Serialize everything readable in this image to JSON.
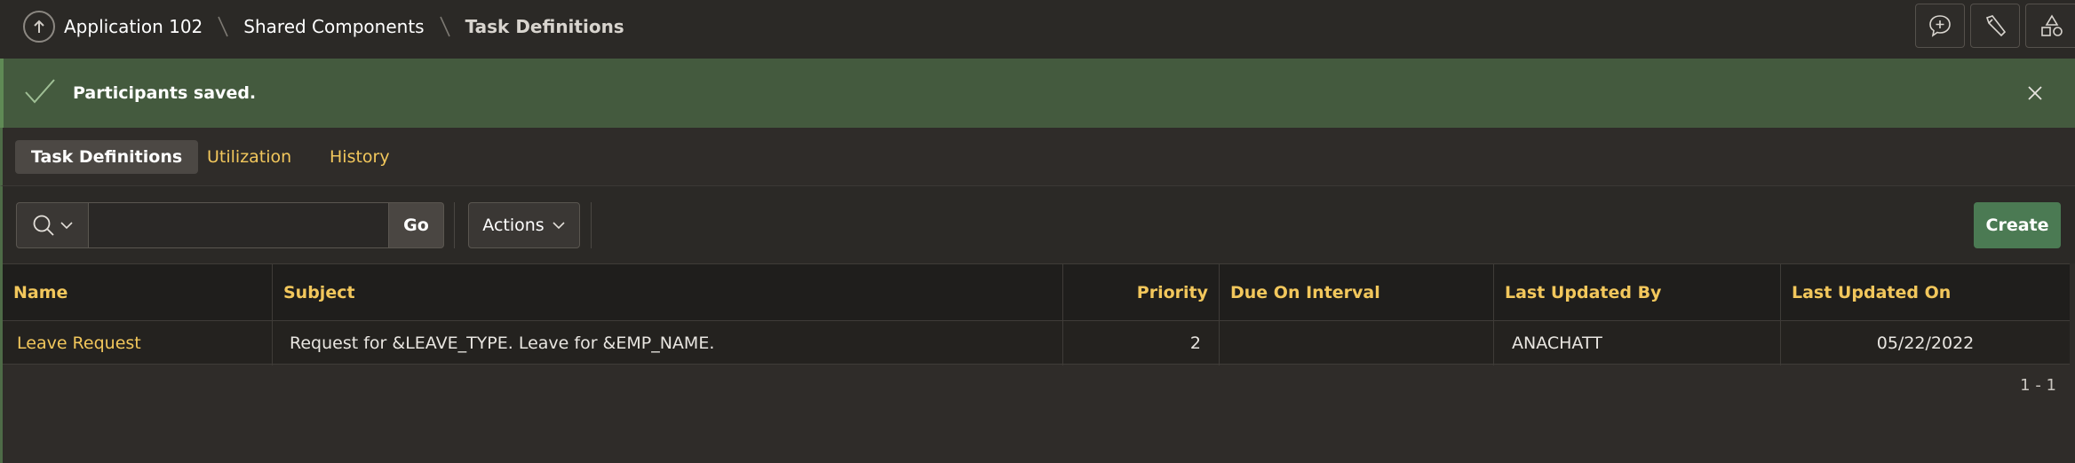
{
  "breadcrumb": {
    "items": [
      "Application 102",
      "Shared Components",
      "Task Definitions"
    ]
  },
  "header_tools": {
    "icons": [
      "feedback-plus-icon",
      "wand-icon",
      "shapes-icon"
    ]
  },
  "banner": {
    "message": "Participants saved."
  },
  "tabs": [
    {
      "label": "Task Definitions",
      "active": true
    },
    {
      "label": "Utilization",
      "active": false
    },
    {
      "label": "History",
      "active": false
    }
  ],
  "toolbar": {
    "search_value": "",
    "go_label": "Go",
    "actions_label": "Actions",
    "create_label": "Create"
  },
  "table": {
    "columns": [
      "Name",
      "Subject",
      "Priority",
      "Due On Interval",
      "Last Updated By",
      "Last Updated On"
    ],
    "rows": [
      {
        "name": "Leave Request",
        "subject": "Request for &LEAVE_TYPE. Leave for &EMP_NAME.",
        "priority": "2",
        "due_on_interval": "",
        "last_updated_by": "ANACHATT",
        "last_updated_on": "05/22/2022"
      }
    ],
    "pagination": "1 - 1"
  },
  "colors": {
    "accent_link": "#f2c75c",
    "success_banner": "#445a3e",
    "create_button": "#4b7a53"
  }
}
